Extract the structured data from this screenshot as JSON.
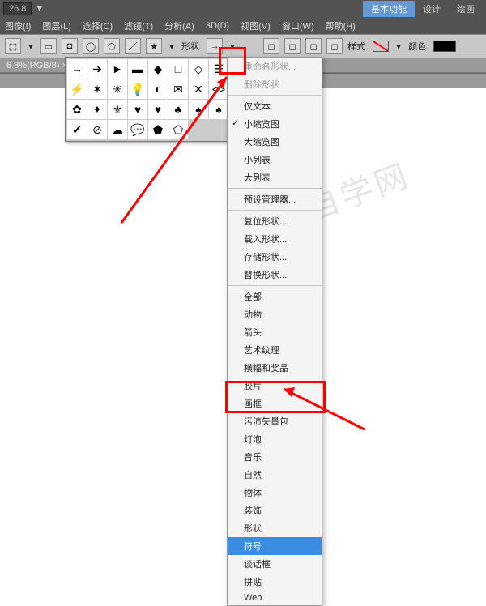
{
  "topbar": {
    "zoom": "26.8",
    "tabs": {
      "basic": "基本功能",
      "design": "设计",
      "paint": "绘画"
    }
  },
  "menus": {
    "image": "图像(I)",
    "layer": "图层(L)",
    "select": "选择(C)",
    "filter": "滤镜(T)",
    "analysis": "分析(A)",
    "threeD": "3D(D)",
    "view": "视图(V)",
    "window": "窗口(W)",
    "help": "帮助(H)"
  },
  "optbar": {
    "shape_label": "形状:",
    "style_label": "样式:",
    "color_label": "颜色:"
  },
  "doc": {
    "tab": "6.8%(RGB/8) ×"
  },
  "shapes": [
    "→",
    "➔",
    "►",
    "▬",
    "◆",
    "□",
    "◇",
    "☰",
    "⚡",
    "✶",
    "✳",
    "💡",
    "◐",
    "✉",
    "✕",
    "<>",
    "✿",
    "✦",
    "⚜",
    "♥",
    "♥",
    "♣",
    "♠",
    "♠",
    "✔",
    "⊘",
    "☁",
    "💬",
    "⬟",
    "⬠"
  ],
  "ctx": {
    "rename": "重命名形状...",
    "delete": "删除形状",
    "textonly": "仅文本",
    "small_thumb": "小缩览图",
    "large_thumb": "大缩览图",
    "small_list": "小列表",
    "large_list": "大列表",
    "preset_mgr": "预设管理器...",
    "reset": "复位形状...",
    "load": "载入形状...",
    "save": "存储形状...",
    "replace": "替换形状...",
    "all": "全部",
    "animals": "动物",
    "arrows": "箭头",
    "artistic": "艺术纹理",
    "banners": "横幅和奖品",
    "film": "胶片",
    "frames": "画框",
    "grime": "污渍矢量包",
    "bulbs": "灯泡",
    "music": "音乐",
    "nature": "自然",
    "objects": "物体",
    "ornaments": "装饰",
    "shapes_cat": "形状",
    "symbols": "符号",
    "talk": "谈话框",
    "tiles": "拼贴",
    "web": "Web"
  },
  "watermark": "软件自学网"
}
